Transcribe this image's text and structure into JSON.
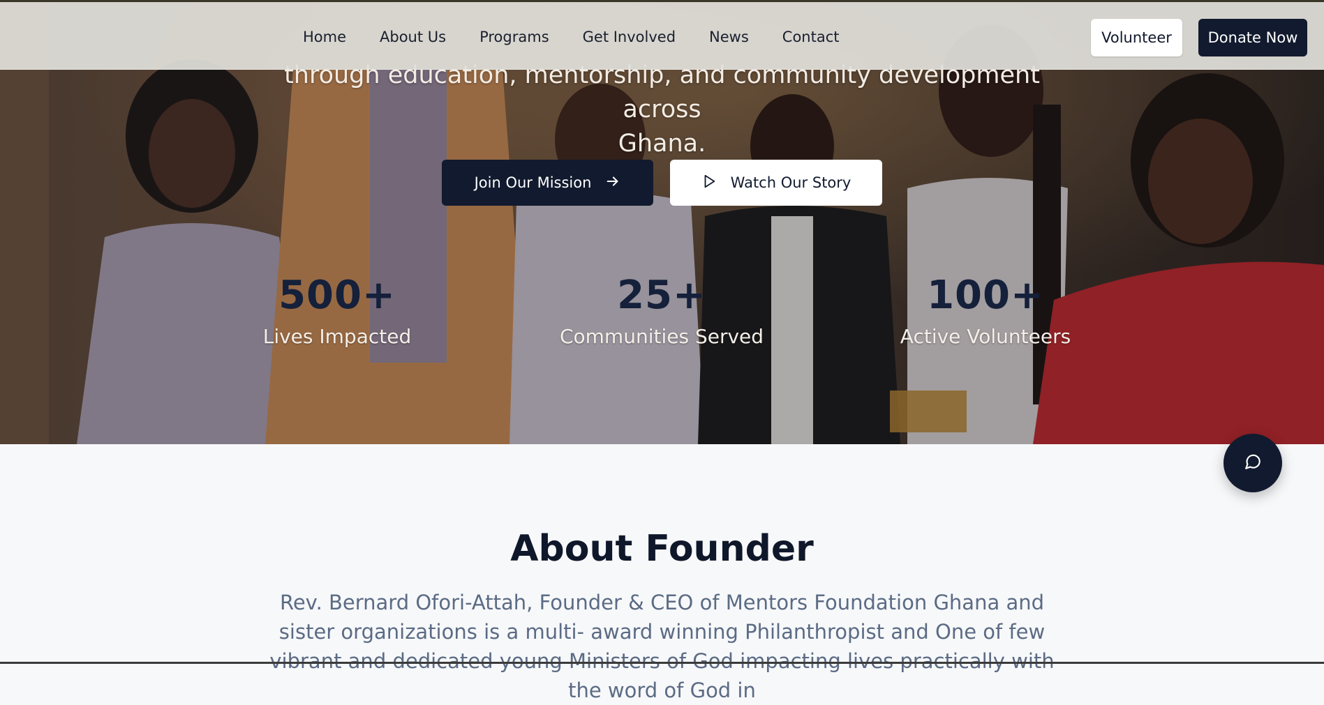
{
  "nav": {
    "links": [
      "Home",
      "About Us",
      "Programs",
      "Get Involved",
      "News",
      "Contact"
    ],
    "volunteer_label": "Volunteer",
    "donate_label": "Donate Now"
  },
  "hero": {
    "subtitle_line1": "through education, mentorship, and community development across",
    "subtitle_line2": "Ghana.",
    "primary_cta": "Join Our Mission",
    "primary_cta_icon": "arrow-right-icon",
    "secondary_cta": "Watch Our Story",
    "secondary_cta_icon": "play-icon",
    "stats": [
      {
        "number": "500+",
        "label": "Lives Impacted"
      },
      {
        "number": "25+",
        "label": "Communities Served"
      },
      {
        "number": "100+",
        "label": "Active Volunteers"
      }
    ]
  },
  "chat": {
    "icon": "chat-bubble-icon"
  },
  "about": {
    "title": "About Founder",
    "text": "Rev. Bernard Ofori-Attah, Founder & CEO of Mentors Foundation Ghana and sister organizations is a multi- award winning Philanthropist and One of few vibrant and dedicated young Ministers of God impacting lives practically with the word of God in"
  },
  "colors": {
    "brand_dark": "#111a2e",
    "stat_number": "#15203a",
    "about_text": "#5b6b84",
    "page_bg": "#f7f8fa"
  }
}
